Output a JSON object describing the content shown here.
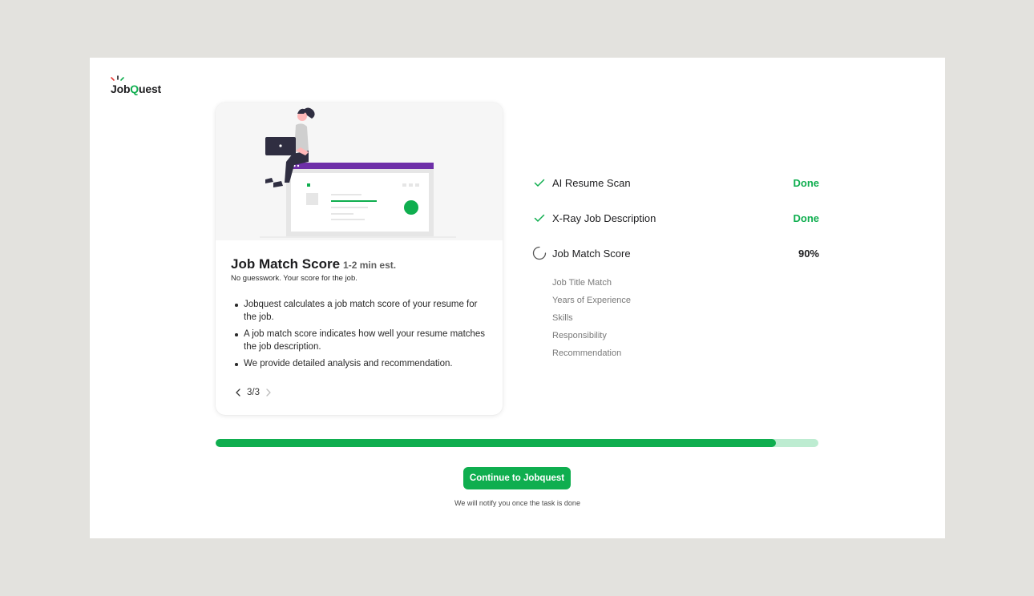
{
  "brand": {
    "name_prefix": "Job",
    "name_q": "Q",
    "name_suffix": "uest",
    "accent": "#0fae4f"
  },
  "card": {
    "title": "Job Match Score",
    "estimate": "1-2 min est.",
    "subtitle": "No guesswork. Your score for the job.",
    "bullets": [
      "Jobquest calculates a job match score of your resume for the job.",
      "A job match score indicates how well your resume matches the job description.",
      "We provide detailed analysis and recommendation."
    ],
    "pager": {
      "text": "3/3",
      "current": 3,
      "total": 3
    }
  },
  "steps": [
    {
      "label": "AI Resume Scan",
      "status": "Done",
      "icon": "check-icon"
    },
    {
      "label": "X-Ray Job Description",
      "status": "Done",
      "icon": "check-icon"
    },
    {
      "label": "Job Match Score",
      "status": "90%",
      "icon": "spinner-icon"
    }
  ],
  "sub_steps": [
    "Job Title Match",
    "Years of Experience",
    "Skills",
    "Responsibility",
    "Recommendation"
  ],
  "progress": {
    "value": 0.93
  },
  "cta": {
    "label": "Continue to Jobquest"
  },
  "note": "We will notify you once the task is done",
  "colors": {
    "green": "#0fae4f",
    "purple": "#6e2fa8",
    "track": "#bdecd1"
  }
}
